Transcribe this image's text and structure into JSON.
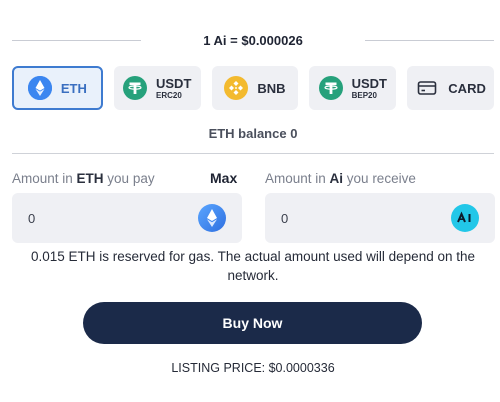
{
  "rate": {
    "text": "1 Ai = $0.000026"
  },
  "tokens": [
    {
      "name": "ETH",
      "sub": "",
      "icon": "ethereum-icon",
      "selected": true
    },
    {
      "name": "USDT",
      "sub": "ERC20",
      "icon": "tether-icon",
      "selected": false
    },
    {
      "name": "BNB",
      "sub": "",
      "icon": "bnb-icon",
      "selected": false
    },
    {
      "name": "USDT",
      "sub": "BEP20",
      "icon": "tether-icon",
      "selected": false
    },
    {
      "name": "CARD",
      "sub": "",
      "icon": "credit-card-icon",
      "selected": false
    }
  ],
  "balance": {
    "text": "ETH balance 0"
  },
  "pay": {
    "label_prefix": "Amount in ",
    "label_token": "ETH",
    "label_suffix": " you pay",
    "max_label": "Max",
    "value": "0",
    "icon": "ethereum-icon"
  },
  "receive": {
    "label_prefix": "Amount in ",
    "label_token": "Ai",
    "label_suffix": " you receive",
    "value": "0",
    "icon": "ai-token-icon"
  },
  "gas_note": "0.015 ETH is reserved for gas. The actual amount used will depend on the network.",
  "buy_button": {
    "label": "Buy Now"
  },
  "listing": {
    "text": "LISTING PRICE: $0.0000336"
  },
  "colors": {
    "accent": "#3e7bd0",
    "button": "#1b2a49",
    "tether": "#26a17b",
    "bnb": "#f3ba2f",
    "ai_token": "#22c7e8"
  }
}
